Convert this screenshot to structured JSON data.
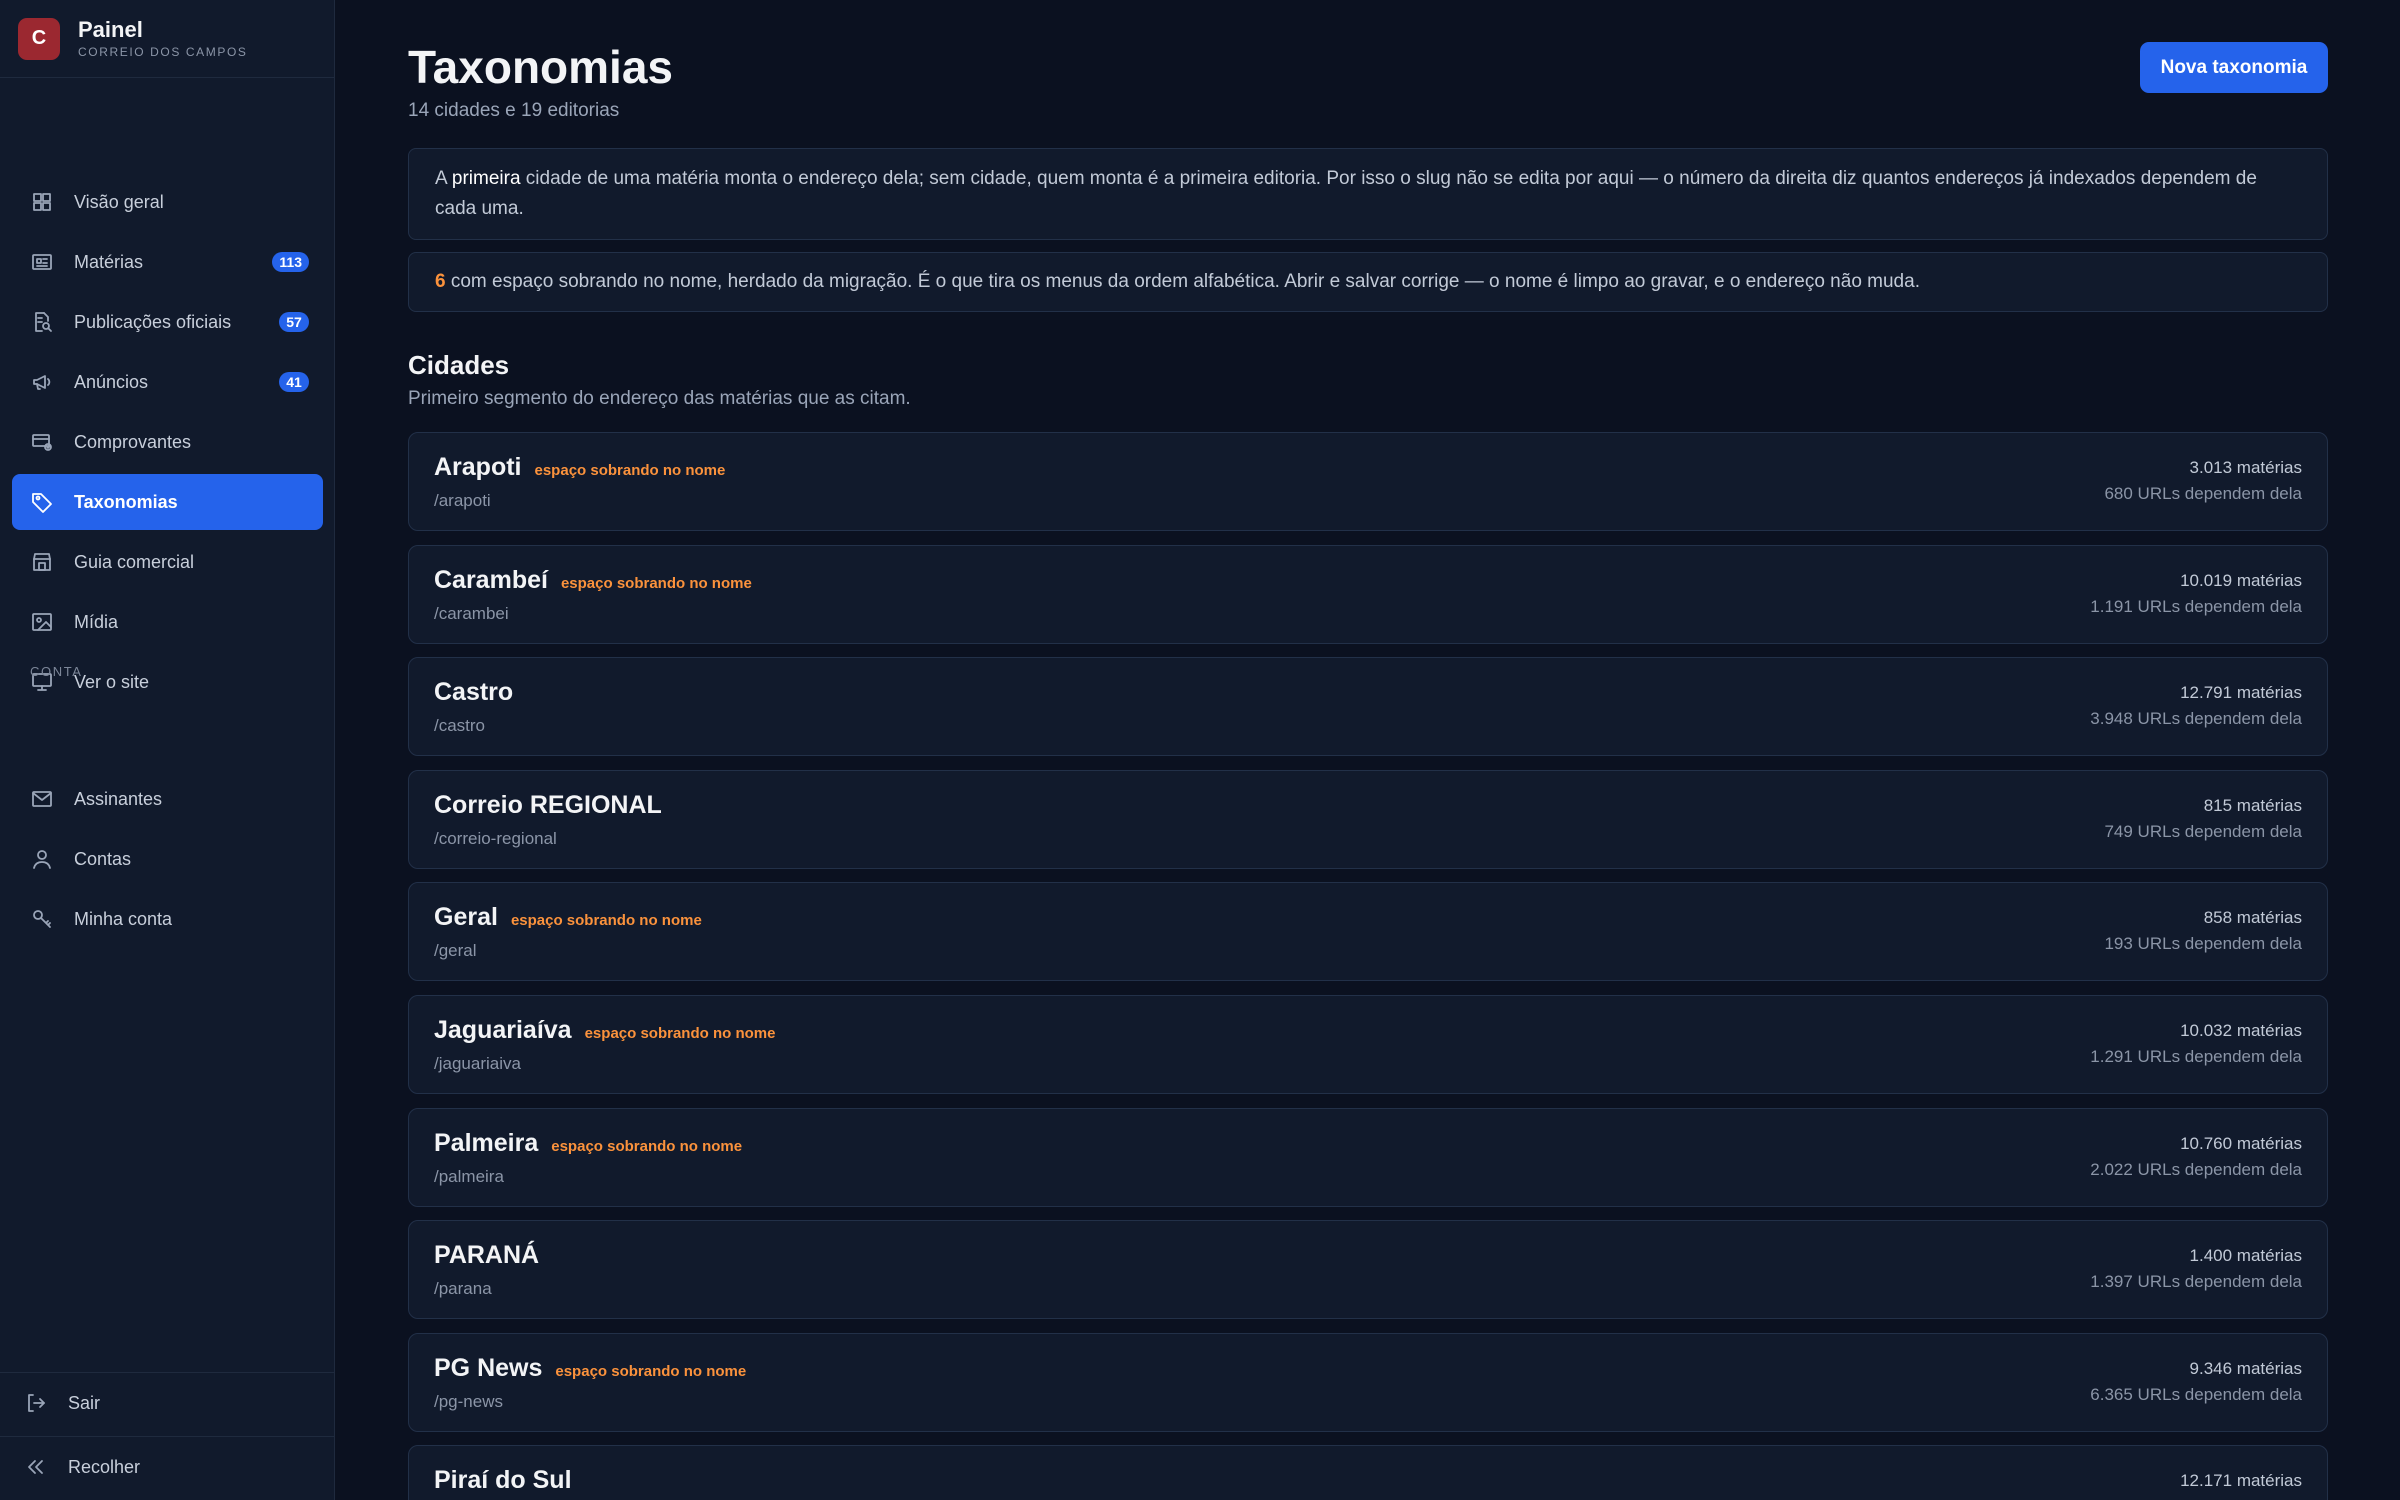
{
  "brand": {
    "logo_letter": "C",
    "title": "Painel",
    "subtitle": "CORREIO DOS CAMPOS"
  },
  "sidebar": {
    "items": [
      {
        "label": "Visão geral",
        "icon": "grid-icon",
        "badge": null,
        "active": false
      },
      {
        "label": "Matérias",
        "icon": "newspaper-icon",
        "badge": "113",
        "active": false
      },
      {
        "label": "Publicações oficiais",
        "icon": "document-search-icon",
        "badge": "57",
        "active": false
      },
      {
        "label": "Anúncios",
        "icon": "megaphone-icon",
        "badge": "41",
        "active": false
      },
      {
        "label": "Comprovantes",
        "icon": "receipt-icon",
        "badge": null,
        "active": false
      },
      {
        "label": "Taxonomias",
        "icon": "tag-icon",
        "badge": null,
        "active": true
      },
      {
        "label": "Guia comercial",
        "icon": "store-icon",
        "badge": null,
        "active": false
      },
      {
        "label": "Mídia",
        "icon": "image-icon",
        "badge": null,
        "active": false
      },
      {
        "label": "Ver o site",
        "icon": "monitor-icon",
        "badge": null,
        "active": false
      }
    ],
    "account_label": "CONTA",
    "account_items": [
      {
        "label": "Assinantes",
        "icon": "mail-icon"
      },
      {
        "label": "Contas",
        "icon": "user-icon"
      },
      {
        "label": "Minha conta",
        "icon": "key-icon"
      }
    ],
    "logout_label": "Sair",
    "collapse_label": "Recolher"
  },
  "header": {
    "title": "Taxonomias",
    "subtitle": "14 cidades e 19 editorias",
    "new_button": "Nova taxonomia"
  },
  "notices": {
    "info_prefix": "A ",
    "info_bold": "primeira",
    "info_rest": " cidade de uma matéria monta o endereço dela; sem cidade, quem monta é a primeira editoria. Por isso o slug não se edita por aqui — o número da direita diz quantos endereços já indexados dependem de cada uma.",
    "warn_count": "6",
    "warn_text": " com espaço sobrando no nome, herdado da migração. É o que tira os menus da ordem alfabética. Abrir e salvar corrige — o nome é limpo ao gravar, e o endereço não muda."
  },
  "cities": {
    "title": "Cidades",
    "subtitle": "Primeiro segmento do endereço das matérias que as citam.",
    "warning_tag": "espaço sobrando no nome",
    "items": [
      {
        "name": "Arapoti",
        "slug": "/arapoti",
        "count": "3.013 matérias",
        "urls": "680 URLs dependem dela",
        "warn": true
      },
      {
        "name": "Carambeí",
        "slug": "/carambei",
        "count": "10.019 matérias",
        "urls": "1.191 URLs dependem dela",
        "warn": true
      },
      {
        "name": "Castro",
        "slug": "/castro",
        "count": "12.791 matérias",
        "urls": "3.948 URLs dependem dela",
        "warn": false
      },
      {
        "name": "Correio REGIONAL",
        "slug": "/correio-regional",
        "count": "815 matérias",
        "urls": "749 URLs dependem dela",
        "warn": false
      },
      {
        "name": "Geral",
        "slug": "/geral",
        "count": "858 matérias",
        "urls": "193 URLs dependem dela",
        "warn": true
      },
      {
        "name": "Jaguariaíva",
        "slug": "/jaguariaiva",
        "count": "10.032 matérias",
        "urls": "1.291 URLs dependem dela",
        "warn": true
      },
      {
        "name": "Palmeira",
        "slug": "/palmeira",
        "count": "10.760 matérias",
        "urls": "2.022 URLs dependem dela",
        "warn": true
      },
      {
        "name": "PARANÁ",
        "slug": "/parana",
        "count": "1.400 matérias",
        "urls": "1.397 URLs dependem dela",
        "warn": false
      },
      {
        "name": "PG News",
        "slug": "/pg-news",
        "count": "9.346 matérias",
        "urls": "6.365 URLs dependem dela",
        "warn": true
      },
      {
        "name": "Piraí do Sul",
        "slug": "",
        "count": "12.171 matérias",
        "urls": "",
        "warn": false
      }
    ]
  }
}
